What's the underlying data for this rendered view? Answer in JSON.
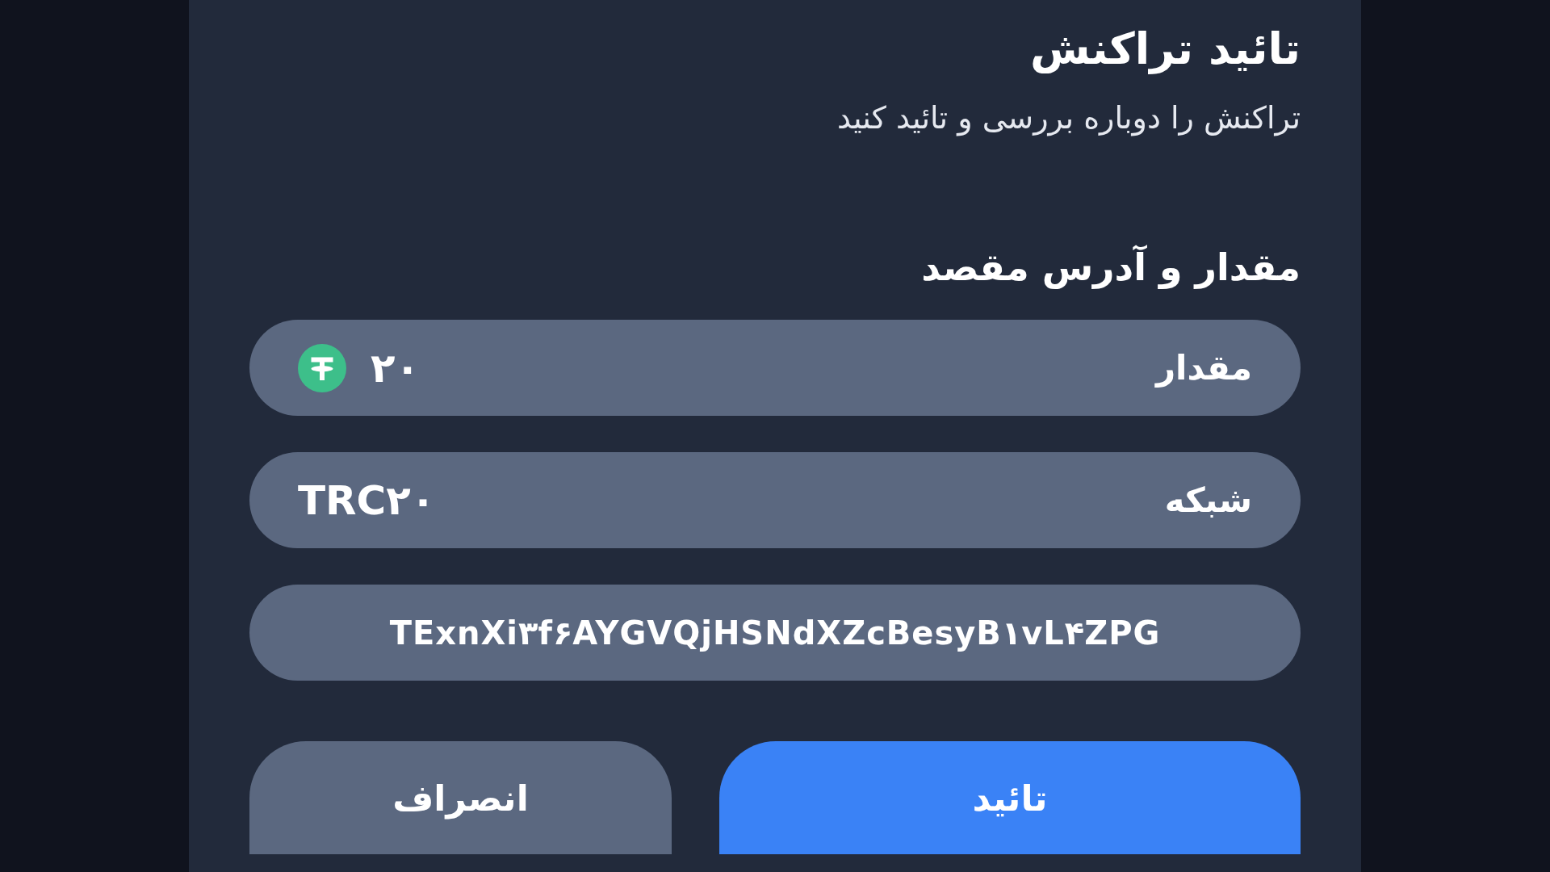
{
  "title": "تائید تراکنش",
  "subtitle": "تراکنش را دوباره بررسی و تائید کنید",
  "section_title": "مقدار و آدرس مقصد",
  "fields": [
    {
      "kind": "amount",
      "label": "مقدار",
      "value": "۲۰"
    },
    {
      "kind": "network",
      "label": "شبکه",
      "value": "TRC۲۰"
    },
    {
      "kind": "address",
      "value": "TExnXi۳f۶AYGVQjHSNdXZcBesyB۱vL۴ZPG"
    }
  ],
  "buttons": [
    {
      "kind": "primary",
      "label": "تائید"
    },
    {
      "kind": "secondary",
      "label": "انصراف"
    }
  ]
}
